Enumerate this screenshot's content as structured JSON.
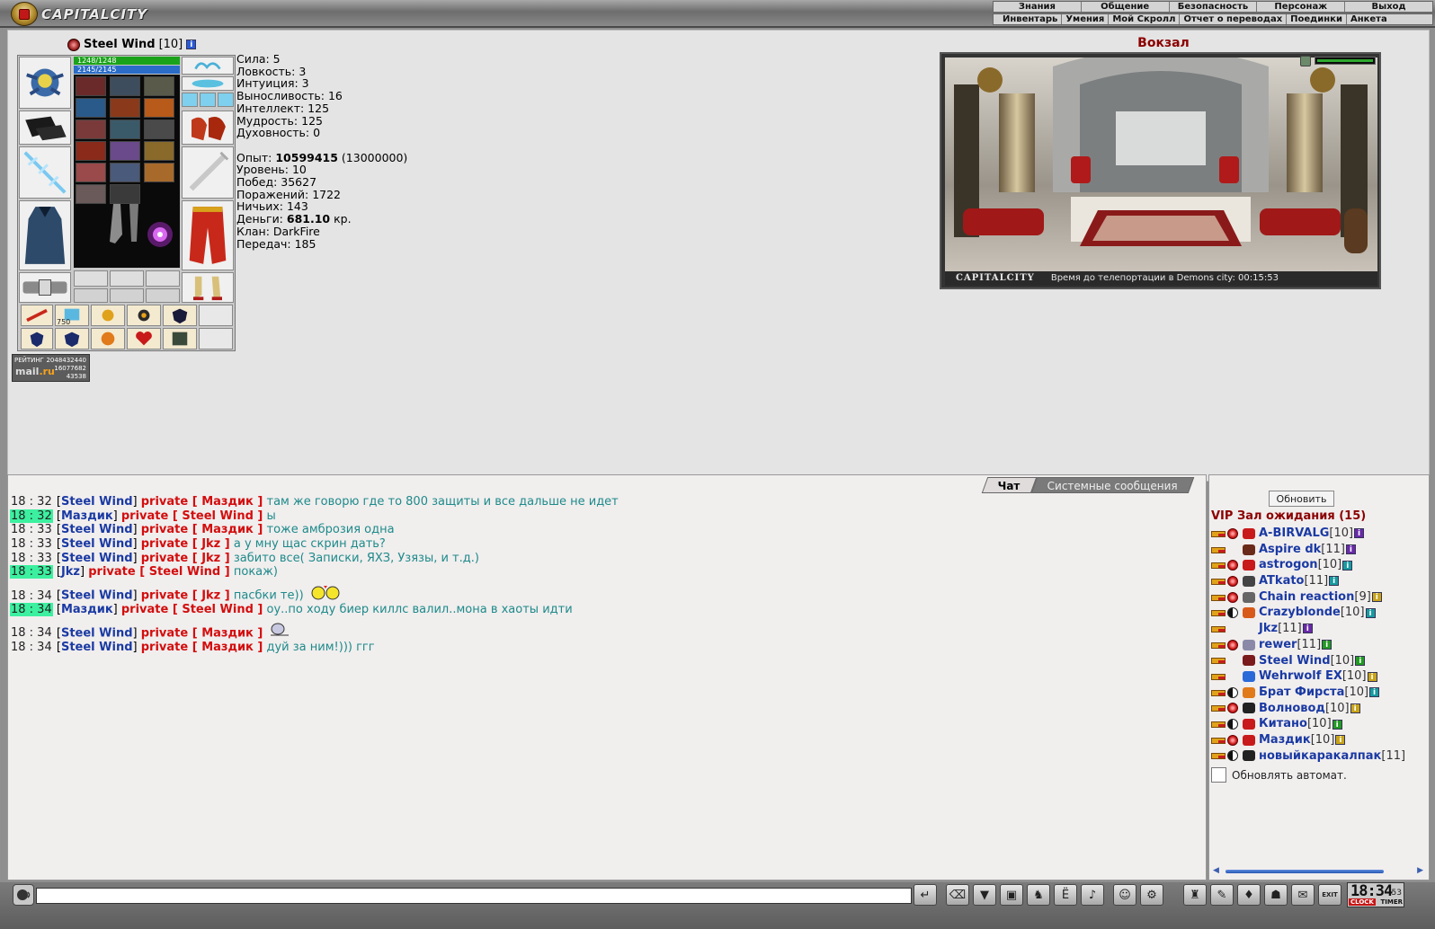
{
  "app": {
    "logo_text": "CAPITALCITY"
  },
  "menu": {
    "main": [
      "Знания",
      "Общение",
      "Безопасность",
      "Персонаж",
      "Выход"
    ],
    "sub": [
      "Инвентарь",
      "Умения",
      "Мой Скролл",
      "Отчет о переводах",
      "Поединки",
      "Анкета"
    ]
  },
  "character": {
    "name": "Steel Wind",
    "level": "[10]",
    "hp": "1248/1248",
    "mp": "2145/2145",
    "item_count_badge": "750",
    "stats": [
      "Сила: 5",
      "Ловкость: 3",
      "Интуиция: 3",
      "Выносливость: 16",
      "Интеллект: 125",
      "Мудрость: 125",
      "Духовность: 0"
    ],
    "exp_label": "Опыт: ",
    "exp_value": "10599415",
    "exp_next": " (13000000)",
    "level_line": "Уровень: 10",
    "wins": "Побед: 35627",
    "losses": "Поражений: 1722",
    "draws": "Ничьих: 143",
    "money_label": "Деньги: ",
    "money_value": "681.10",
    "money_unit": " кр.",
    "clan": "Клан: DarkFire",
    "transfers": "Передач: 185"
  },
  "rating": {
    "label": "РЕЙТИНГ",
    "n1": "2048432440",
    "logo_a": "mail",
    "logo_b": ".ru",
    "n2": "16077682",
    "n3": "43538"
  },
  "location": {
    "title": "Вокзал",
    "caption_city": "CAPITALCITY",
    "caption_text": "Время до телепортации в Demons city: 00:15:53"
  },
  "chat": {
    "tabs": [
      "Чат",
      "Системные сообщения"
    ],
    "lines": [
      {
        "time": "18 : 32",
        "hl": false,
        "from": "Steel Wind",
        "to": "Маздик",
        "text": "там же говорю где то 800 защиты и все дальше не идет"
      },
      {
        "time": "18 : 32",
        "hl": true,
        "from": "Маздик",
        "to": "Steel Wind",
        "text": "ы"
      },
      {
        "time": "18 : 33",
        "hl": false,
        "from": "Steel Wind",
        "to": "Маздик",
        "text": "тоже амброзия одна"
      },
      {
        "time": "18 : 33",
        "hl": false,
        "from": "Steel Wind",
        "to": "Jkz",
        "text": "а у мну щас скрин дать?"
      },
      {
        "time": "18 : 33",
        "hl": false,
        "from": "Steel Wind",
        "to": "Jkz",
        "text": "забито все( Записки, ЯХЗ, Узязы, и т.д.)"
      },
      {
        "time": "18 : 33",
        "hl": true,
        "from": "Jkz",
        "to": "Steel Wind",
        "text": "покаж)"
      },
      {
        "time": "18 : 34",
        "hl": false,
        "from": "Steel Wind",
        "to": "Jkz",
        "text": "пасбки те))"
      },
      {
        "time": "18 : 34",
        "hl": true,
        "from": "Маздик",
        "to": "Steel Wind",
        "text": "оу..по ходу биер киллс валил..мона в хаоты идти"
      },
      {
        "time": "18 : 34",
        "hl": false,
        "from": "Steel Wind",
        "to": "Маздик",
        "text": ""
      },
      {
        "time": "18 : 34",
        "hl": false,
        "from": "Steel Wind",
        "to": "Маздик",
        "text": "дуй за ним!))) ггг"
      }
    ],
    "private_word": "private"
  },
  "online": {
    "refresh_label": "Обновить",
    "room_title": "VIP Зал ожидания (15)",
    "users": [
      {
        "name": "A-BIRVALG",
        "level": "[10]",
        "info": "purple"
      },
      {
        "name": "Aspire dk",
        "level": "[11]",
        "info": "purple"
      },
      {
        "name": "astrogon",
        "level": "[10]",
        "info": "teal"
      },
      {
        "name": "ATkato",
        "level": "[11]",
        "info": "teal"
      },
      {
        "name": "Chain reaction",
        "level": "[9]",
        "info": "gold"
      },
      {
        "name": "Crazyblonde",
        "level": "[10]",
        "info": "teal"
      },
      {
        "name": "Jkz",
        "level": "[11]",
        "info": "purple"
      },
      {
        "name": "rewer",
        "level": "[11]",
        "info": "green"
      },
      {
        "name": "Steel Wind",
        "level": "[10]",
        "info": "green"
      },
      {
        "name": "Wehrwolf EX",
        "level": "[10]",
        "info": "gold"
      },
      {
        "name": "Брат Фирста",
        "level": "[10]",
        "info": "teal"
      },
      {
        "name": "Волновод",
        "level": "[10]",
        "info": "gold"
      },
      {
        "name": "Китано",
        "level": "[10]",
        "info": "green"
      },
      {
        "name": "Маздик",
        "level": "[10]",
        "info": "gold"
      },
      {
        "name": "новыйкаракалпак",
        "level": "[11]",
        "info": ""
      }
    ],
    "auto_refresh_label": "Обновлять автомат."
  },
  "bottom": {
    "input_value": "",
    "clock_time": "18:34",
    "clock_seconds": "53",
    "clock_label": "CLOCK",
    "timer_label": "TIMER",
    "exit_label": "EXIT"
  },
  "colors": {
    "nick": "#1a3aa3",
    "private": "#d30d0d",
    "message": "#1e8a8a",
    "highlight_time": "#3cf0a0",
    "room_title": "#8b0000"
  }
}
